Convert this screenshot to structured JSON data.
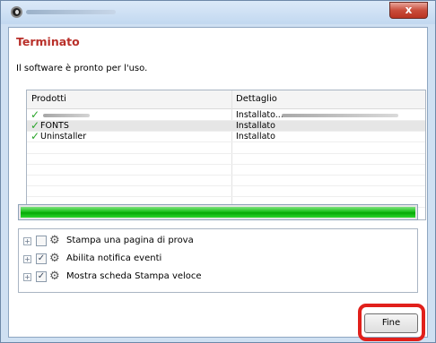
{
  "window": {
    "close_label": "x"
  },
  "header": {
    "title": "Terminato",
    "subtitle": "Il software è pronto per l'uso."
  },
  "table": {
    "columns": [
      "Prodotti",
      "Dettaglio"
    ],
    "rows": [
      {
        "name": "",
        "detail": "Installato..."
      },
      {
        "name": "FONTS",
        "detail": "Installato"
      },
      {
        "name": "Uninstaller",
        "detail": "Installato"
      }
    ]
  },
  "progress": {
    "value": 1.0,
    "color": "#1cc11c"
  },
  "options": [
    {
      "label": "Stampa una pagina di prova",
      "checked": false
    },
    {
      "label": "Abilita notifica eventi",
      "checked": true
    },
    {
      "label": "Mostra scheda Stampa veloce",
      "checked": true
    }
  ],
  "footer": {
    "finish_label": "Fine",
    "highlight_color": "#e1201b"
  }
}
